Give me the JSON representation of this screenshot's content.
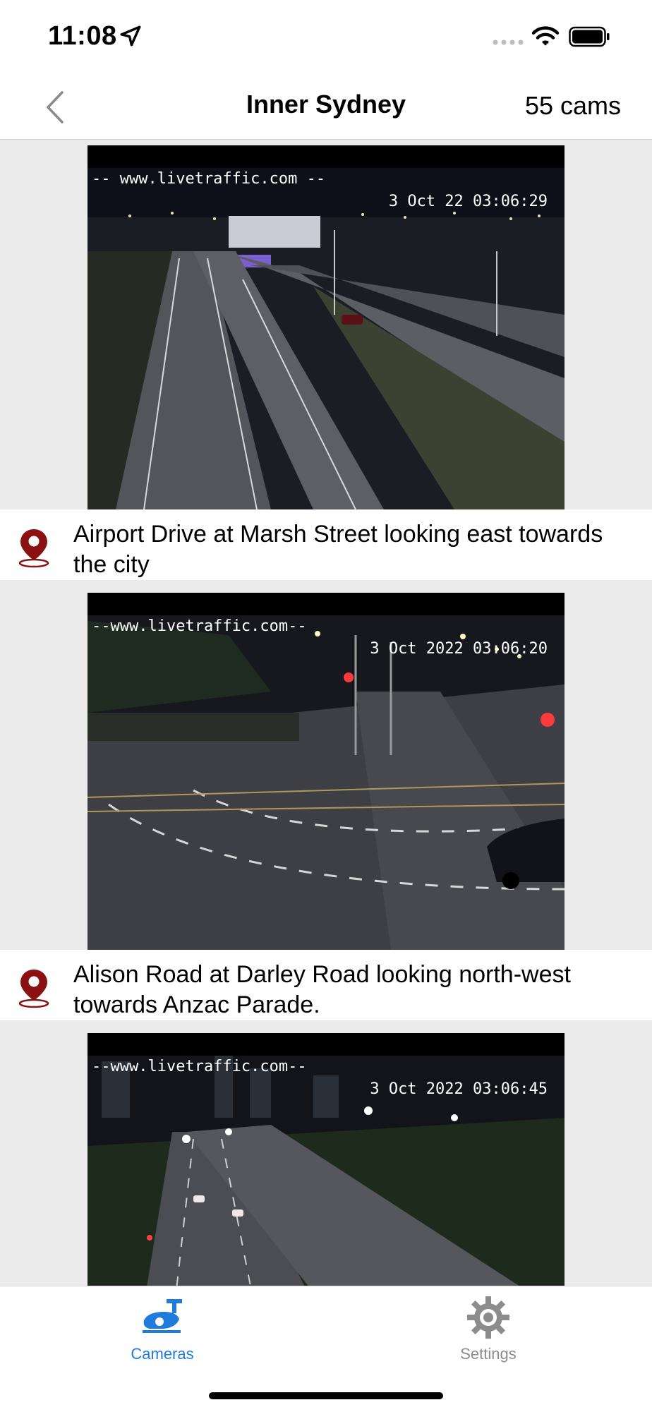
{
  "status_bar": {
    "time": "11:08"
  },
  "nav": {
    "title": "Inner Sydney",
    "count": "55 cams"
  },
  "cameras": [
    {
      "url": "-- www.livetraffic.com --",
      "timestamp": "3 Oct 22 03:06:29",
      "caption": "Airport Drive at Marsh Street  looking east towards the city"
    },
    {
      "url": "--www.livetraffic.com--",
      "timestamp": "3 Oct 2022 03:06:20",
      "caption": "Alison Road at Darley Road looking north-west towards Anzac Parade."
    },
    {
      "url": "--www.livetraffic.com--",
      "timestamp": "3 Oct 2022 03:06:45",
      "caption": ""
    }
  ],
  "tabs": {
    "cameras": "Cameras",
    "settings": "Settings"
  },
  "colors": {
    "accent": "#1f7bdc",
    "pin": "#8b1010",
    "inactive_tab": "#8c8c8c"
  }
}
